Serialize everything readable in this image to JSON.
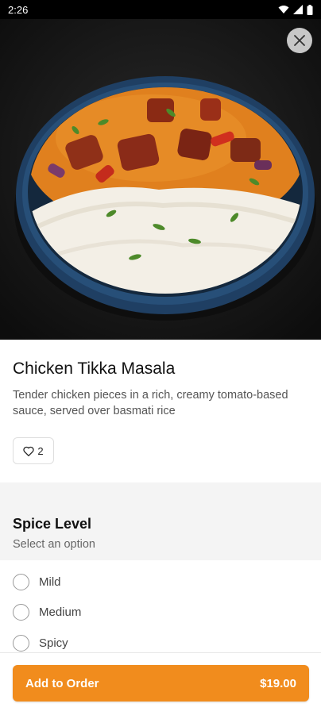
{
  "status_bar": {
    "time": "2:26"
  },
  "item": {
    "title": "Chicken Tikka Masala",
    "description": "Tender chicken pieces in a rich, creamy tomato-based sauce, served over basmati rice",
    "likes": "2"
  },
  "spice_section": {
    "title": "Spice Level",
    "subtitle": "Select an option",
    "options": [
      {
        "label": "Mild",
        "selected": false
      },
      {
        "label": "Medium",
        "selected": false
      },
      {
        "label": "Spicy",
        "selected": false
      }
    ]
  },
  "order_button": {
    "label": "Add to Order",
    "price": "$19.00"
  },
  "colors": {
    "accent": "#f18c1d",
    "sauce": "#e0801e",
    "bowl": "#1f3f63"
  },
  "icons": [
    "wifi-icon",
    "signal-icon",
    "battery-icon",
    "close-icon",
    "heart-icon"
  ]
}
